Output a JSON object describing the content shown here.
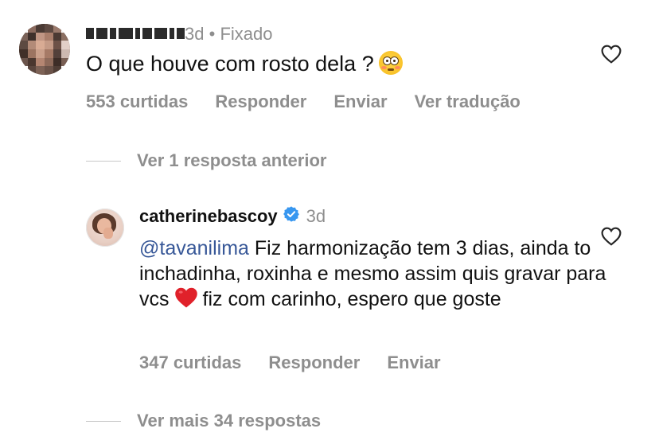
{
  "comment": {
    "time": "3d",
    "separator": "•",
    "pinned_label": "Fixado",
    "text": "O que houve com rosto dela ?",
    "emoji": "flushed-face-emoji",
    "likes": "553 curtidas",
    "reply_label": "Responder",
    "send_label": "Enviar",
    "translate_label": "Ver tradução"
  },
  "view_previous_label": "Ver 1 resposta anterior",
  "reply": {
    "username": "catherinebascoy",
    "verified": true,
    "time": "3d",
    "mention": "@tavanilima",
    "text_part1": " Fiz harmonização tem 3 dias, ainda to inchadinha, roxinha e mesmo assim quis gravar para vcs",
    "emoji": "red-heart-emoji",
    "text_part2": "fiz com carinho, espero que goste",
    "likes": "347 curtidas",
    "reply_label": "Responder",
    "send_label": "Enviar"
  },
  "view_more_label": "Ver mais 34 respostas",
  "colors": {
    "muted": "#8e8e8e",
    "mention": "#385898",
    "verified": "#3897f0",
    "heart": "#e0212a"
  }
}
